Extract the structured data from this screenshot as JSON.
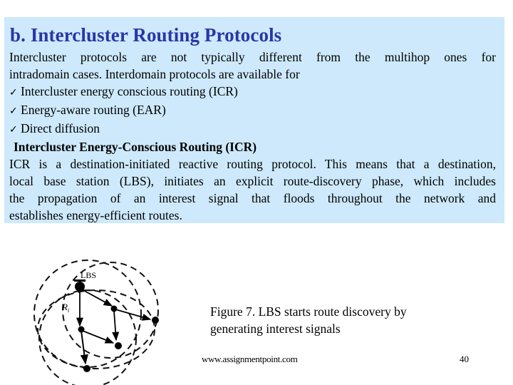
{
  "slide": {
    "title": "b. Intercluster Routing Protocols",
    "intro_lines": [
      "Intercluster protocols are not typically different from the multihop ones for",
      "intradomain cases. Interdomain protocols are available for"
    ],
    "bullets": [
      {
        "icon": "checkmark-icon",
        "glyph": "✓",
        "text": "Intercluster energy conscious routing (ICR)"
      },
      {
        "icon": "checkmark-icon",
        "glyph": "✓",
        "text": "Energy-aware routing (EAR)"
      },
      {
        "icon": "checkmark-icon",
        "glyph": "✓",
        "text": "Direct diffusion"
      }
    ],
    "subheading": "Intercluster Energy-Conscious Routing (ICR)",
    "body_lines": [
      "ICR is a destination-initiated reactive routing protocol. This means that a destination,",
      "local base station (LBS), initiates an explicit route-discovery phase, which includes",
      "the propagation of an interest signal that floods throughout the network and",
      "establishes energy-efficient routes."
    ]
  },
  "figure": {
    "lbs_label": "LBS",
    "ri_label": "R",
    "ri_subscript": "i",
    "caption_lines": [
      "Figure 7. LBS starts route discovery by",
      "generating interest signals"
    ]
  },
  "footer": {
    "url": "www.assignmentpoint.com",
    "page_number": "40"
  },
  "colors": {
    "title": "#2b35a8",
    "box_background": "#cde9fb"
  }
}
